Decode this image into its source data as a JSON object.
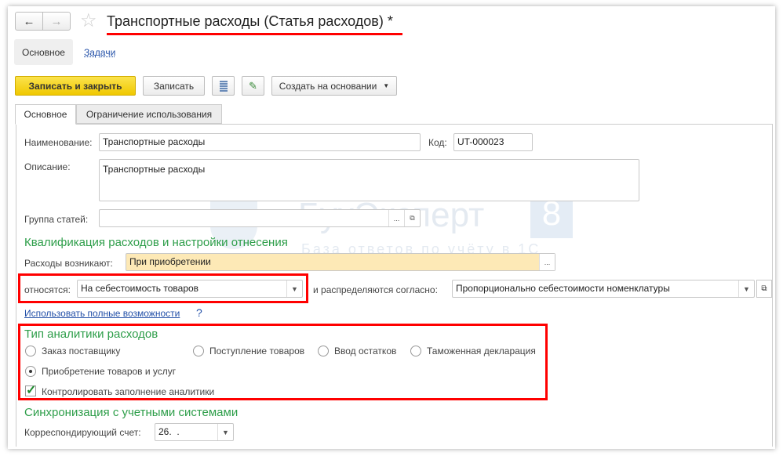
{
  "title": "Транспортные расходы (Статья расходов)",
  "modified_mark": "*",
  "nav": {
    "main": "Основное",
    "tasks": "Задачи"
  },
  "toolbar": {
    "save_close": "Записать и закрыть",
    "save": "Записать",
    "create_based": "Создать на основании"
  },
  "tabs": [
    "Основное",
    "Ограничение использования"
  ],
  "fields": {
    "name_label": "Наименование:",
    "name_value": "Транспортные расходы",
    "code_label": "Код:",
    "code_value": "UT-000023",
    "desc_label": "Описание:",
    "desc_value": "Транспортные расходы",
    "group_label": "Группа статей:",
    "group_value": ""
  },
  "qualification": {
    "header": "Квалификация расходов и настройки отнесения",
    "arise_label": "Расходы возникают:",
    "arise_value": "При приобретении",
    "relate_label": "относятся:",
    "relate_value": "На себестоимость товаров",
    "distrib_label": "и распределяются согласно:",
    "distrib_value": "Пропорционально себестоимости номенклатуры",
    "full_link": "Использовать полные возможности",
    "help": "?"
  },
  "analytics": {
    "header": "Тип аналитики расходов",
    "options": [
      {
        "label": "Заказ поставщику",
        "selected": false
      },
      {
        "label": "Поступление товаров",
        "selected": false
      },
      {
        "label": "Ввод остатков",
        "selected": false
      },
      {
        "label": "Таможенная декларация",
        "selected": false
      },
      {
        "label": "Приобретение товаров и услуг",
        "selected": true
      }
    ],
    "control_label": "Контролировать заполнение аналитики",
    "control_checked": true
  },
  "sync": {
    "header": "Синхронизация с учетными системами",
    "account_label": "Корреспондирующий счет:",
    "account_value": "26.  ."
  },
  "watermark": {
    "brand": "БухЭксперт",
    "num": "8",
    "tagline": "База ответов по учёту в 1С"
  },
  "colors": {
    "accent_green": "#2e9e4a",
    "highlight_red": "#ff0000",
    "primary_button": "#f5d21a"
  }
}
